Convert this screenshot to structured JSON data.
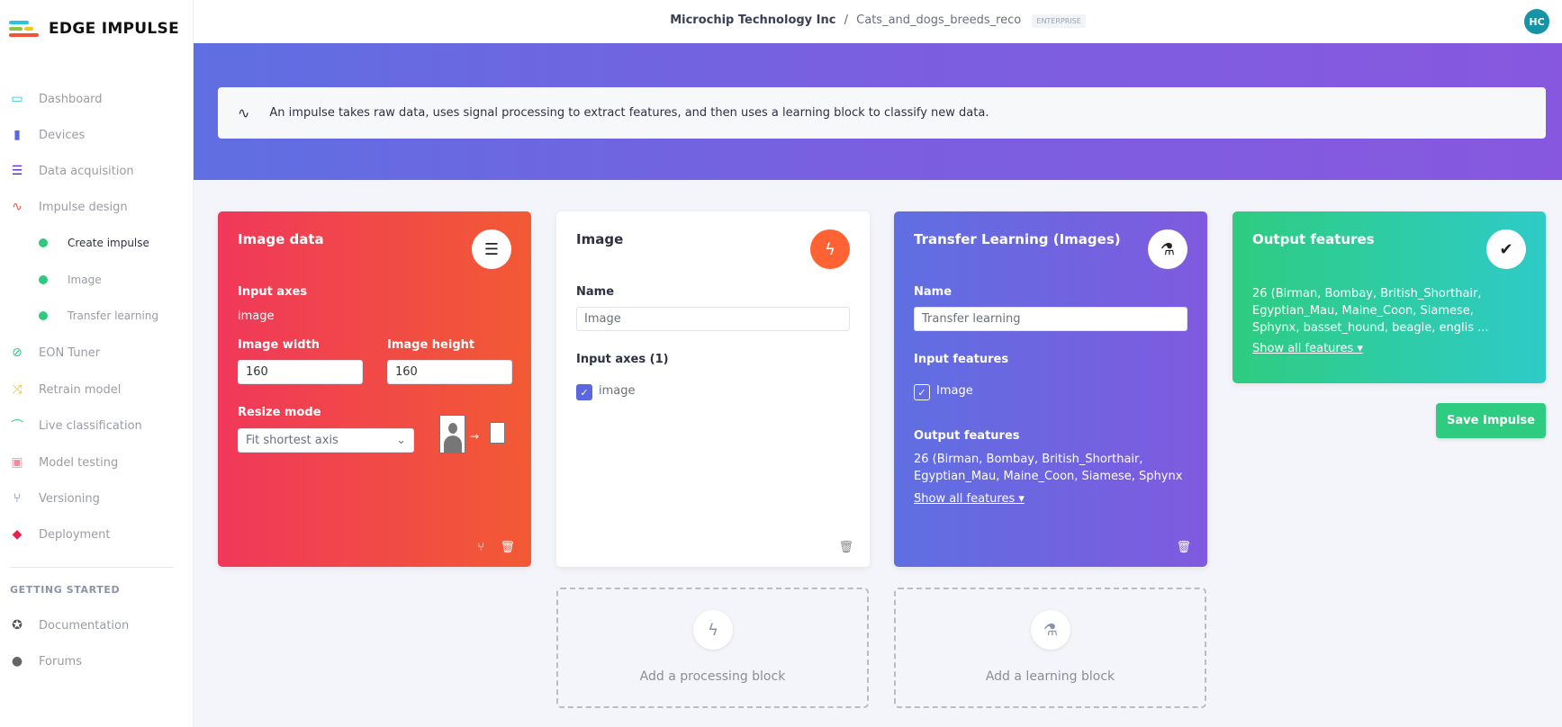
{
  "brand": {
    "name": "EDGE IMPULSE"
  },
  "header": {
    "org": "Microchip Technology Inc",
    "separator": "/",
    "project": "Cats_and_dogs_breeds_reco",
    "badge": "ENTERPRISE",
    "avatar": "HC"
  },
  "sidebar": {
    "items": [
      {
        "label": "Dashboard",
        "icon": "monitor-icon",
        "color": "#2bc3e0"
      },
      {
        "label": "Devices",
        "icon": "chip-icon",
        "color": "#5b67e0"
      },
      {
        "label": "Data acquisition",
        "icon": "database-icon",
        "color": "#5a23c8"
      },
      {
        "label": "Impulse design",
        "icon": "pulse-icon",
        "color": "#f0533a"
      },
      {
        "label": "Create impulse",
        "sub": true
      },
      {
        "label": "Image",
        "sub": true
      },
      {
        "label": "Transfer learning",
        "sub": true
      },
      {
        "label": "EON Tuner",
        "icon": "compass-icon",
        "color": "#2ec97f"
      },
      {
        "label": "Retrain model",
        "icon": "shuffle-icon",
        "color": "#f5c518"
      },
      {
        "label": "Live classification",
        "icon": "bezier-icon",
        "color": "#2ec97f"
      },
      {
        "label": "Model testing",
        "icon": "clipboard-check-icon",
        "color": "#f28ba0"
      },
      {
        "label": "Versioning",
        "icon": "branch-icon",
        "color": "#5b67e0"
      },
      {
        "label": "Deployment",
        "icon": "cube-icon",
        "color": "#e8204a"
      }
    ],
    "section": "GETTING STARTED",
    "extra": [
      {
        "label": "Documentation",
        "icon": "rocket-icon"
      },
      {
        "label": "Forums",
        "icon": "chat-icon"
      }
    ]
  },
  "info": "An impulse takes raw data, uses signal processing to extract features, and then uses a learning block to classify new data.",
  "input_block": {
    "title": "Image data",
    "axes_label": "Input axes",
    "axes_value": "image",
    "width_label": "Image width",
    "width": "160",
    "height_label": "Image height",
    "height": "160",
    "resize_label": "Resize mode",
    "resize_value": "Fit shortest axis"
  },
  "processing_block": {
    "title": "Image",
    "name_label": "Name",
    "name_value": "Image",
    "axes_label": "Input axes (1)",
    "axis": "image"
  },
  "learning_block": {
    "title": "Transfer Learning (Images)",
    "name_label": "Name",
    "name_value": "Transfer learning",
    "input_label": "Input features",
    "input_feature": "Image",
    "output_label": "Output features",
    "output_text": "26 (Birman, Bombay, British_Shorthair, Egyptian_Mau, Maine_Coon, Siamese, Sphynx ...",
    "show_all": "Show all features ▾"
  },
  "output_block": {
    "title": "Output features",
    "output_text": "26 (Birman, Bombay, British_Shorthair, Egyptian_Mau, Maine_Coon, Siamese, Sphynx, basset_hound, beagle, englis ...",
    "show_all": "Show all features ▾"
  },
  "save_label": "Save Impulse",
  "add_processing": "Add a processing block",
  "add_learning": "Add a learning block",
  "colors": {
    "input": "#f0385a",
    "processing": "#ff6333",
    "learning": "#6a5fe2",
    "output": "#2ecc80",
    "save": "#2ecc80"
  }
}
